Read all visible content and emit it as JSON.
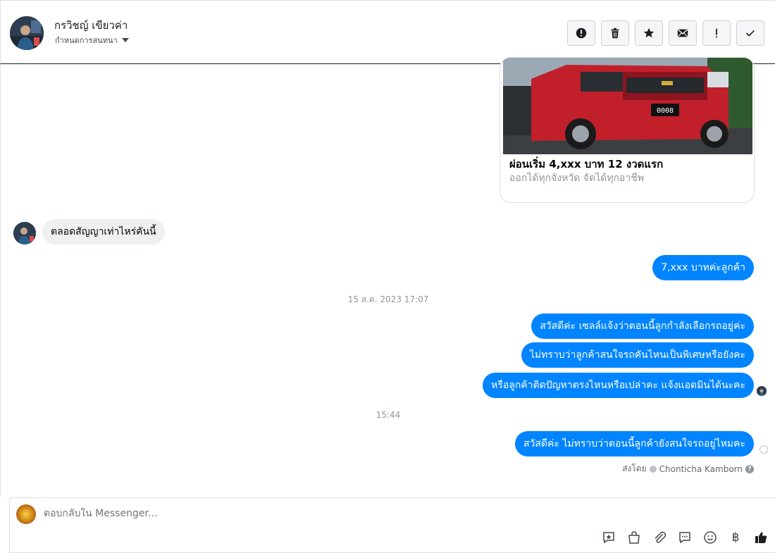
{
  "header": {
    "contact_name": "กรวิชญ์ เขียวค่า",
    "assign_label": "กำหนดการสนทนา",
    "actions": [
      {
        "name": "report-spam-button",
        "icon": "alert-circle-icon"
      },
      {
        "name": "delete-button",
        "icon": "trash-icon"
      },
      {
        "name": "star-button",
        "icon": "star-icon"
      },
      {
        "name": "mark-unread-button",
        "icon": "envelope-icon"
      },
      {
        "name": "follow-up-button",
        "icon": "exclamation-icon"
      },
      {
        "name": "mark-done-button",
        "icon": "check-icon"
      }
    ]
  },
  "card": {
    "title": "ผ่อนเริ่ม 4,xxx บาท 12 งวดแรก",
    "subtitle": "ออกได้ทุกจังหวัด จัดได้ทุกอาชีพ",
    "plate_text": "0008"
  },
  "messages": {
    "incoming_1": "ตลอดสัญญาเท่าไหร่คันนี้",
    "outgoing_1": "7,xxx บาทค่ะลูกค้า",
    "timestamp_1": "15 ส.ค. 2023 17:07",
    "outgoing_2": "สวัสดีค่ะ เซลล์แจ้งว่าตอนนี้ลูกกำลังเลือกรถอยู่ค่ะ",
    "outgoing_3": "ไม่ทราบว่าลูกค้าสนใจรถคันไหนเป็นพิเศษหรือยังคะ",
    "outgoing_4": "หรือลูกค้าติดปัญหาตรงไหนหรือเปล่าคะ แจ้งแอดมินได้นะคะ",
    "timestamp_2": "15:44",
    "outgoing_5": "สวัสดีค่ะ ไม่ทราบว่าตอนนี้ลูกค้ายังสนใจรถอยู่ไหมคะ",
    "sent_by_label": "ส่งโดย",
    "sent_by_name": "Chonticha Kamborn",
    "help_mark": "?"
  },
  "composer": {
    "placeholder": "ตอบกลับใน Messenger...",
    "currency_symbol": "฿"
  },
  "colors": {
    "outgoing_bubble": "#0084ff",
    "incoming_bubble": "#eff0f2",
    "muted_text": "#90949c"
  }
}
